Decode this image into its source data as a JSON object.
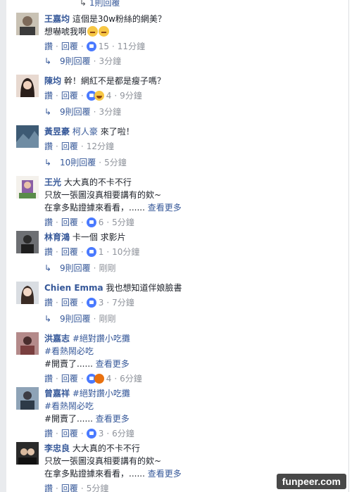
{
  "top_partial": {
    "icon": "reply-arrow-icon",
    "text": "1則回覆"
  },
  "actions": {
    "like": "讚",
    "reply": "回覆"
  },
  "comments": [
    {
      "author": "王嘉均",
      "lines": [
        "這個是30w粉絲的網美？",
        "想嚇唬我啊"
      ],
      "emoji": [
        "thinking-face",
        "thinking-face"
      ],
      "reactions": [
        "like"
      ],
      "reaction_count": "15",
      "time": "11分鐘",
      "replies": "9則回覆",
      "replies_time": "3分鐘"
    },
    {
      "author": "陳均",
      "lines": [
        "幹！網紅不是都是瘦子嗎？"
      ],
      "reactions": [
        "like",
        "haha"
      ],
      "reaction_count": "4",
      "time": "9分鐘",
      "replies": "9則回覆",
      "replies_time": "3分鐘"
    },
    {
      "author": "黃昱豪",
      "tag": "柯人豪",
      "lines": [
        "來了啦！"
      ],
      "reactions": [],
      "reaction_count": "",
      "time": "12分鐘",
      "replies": "10則回覆",
      "replies_time": "5分鐘"
    },
    {
      "author": "王光",
      "lines": [
        "大大真的不卡不行",
        "只放一張圖沒真相要講有的欸~",
        "在拿多點證據來看看，......"
      ],
      "see_more": "查看更多",
      "reactions": [
        "like"
      ],
      "reaction_count": "6",
      "time": "5分鐘"
    },
    {
      "author": "林育鴻",
      "lines": [
        "卡一個 求影片"
      ],
      "reactions": [
        "like"
      ],
      "reaction_count": "1",
      "time": "10分鐘",
      "replies": "9則回覆",
      "replies_time": "剛剛"
    },
    {
      "author": "Chien Emma",
      "lines": [
        "我也想知道伴娘臉書"
      ],
      "reactions": [
        "like"
      ],
      "reaction_count": "3",
      "time": "7分鐘",
      "replies": "9則回覆",
      "replies_time": "剛剛"
    },
    {
      "author": "洪嘉志",
      "tag": "#絕對讚小吃攤",
      "lines": [
        "#看熱鬧必吃",
        "#開賣了......"
      ],
      "see_more": "查看更多",
      "reactions": [
        "like",
        "angry"
      ],
      "reaction_count": "4",
      "time": "6分鐘"
    },
    {
      "author": "曾嘉祥",
      "tag": "#絕對讚小吃攤",
      "lines": [
        "#看熱鬧必吃",
        "#開賣了......"
      ],
      "see_more": "查看更多",
      "reactions": [
        "like"
      ],
      "reaction_count": "3",
      "time": "6分鐘"
    },
    {
      "author": "李忠良",
      "lines": [
        "大大真的不卡不行",
        "只放一張圖沒真相要講有的欸~",
        "在拿多點證據來看看，......"
      ],
      "see_more": "查看更多",
      "reactions": [],
      "reaction_count": "",
      "time": "5分鐘"
    }
  ],
  "watermark": "funpeer.com",
  "colors": {
    "link": "#365899",
    "meta": "#90949c",
    "text": "#1d2129",
    "like": "#4a7aff"
  }
}
